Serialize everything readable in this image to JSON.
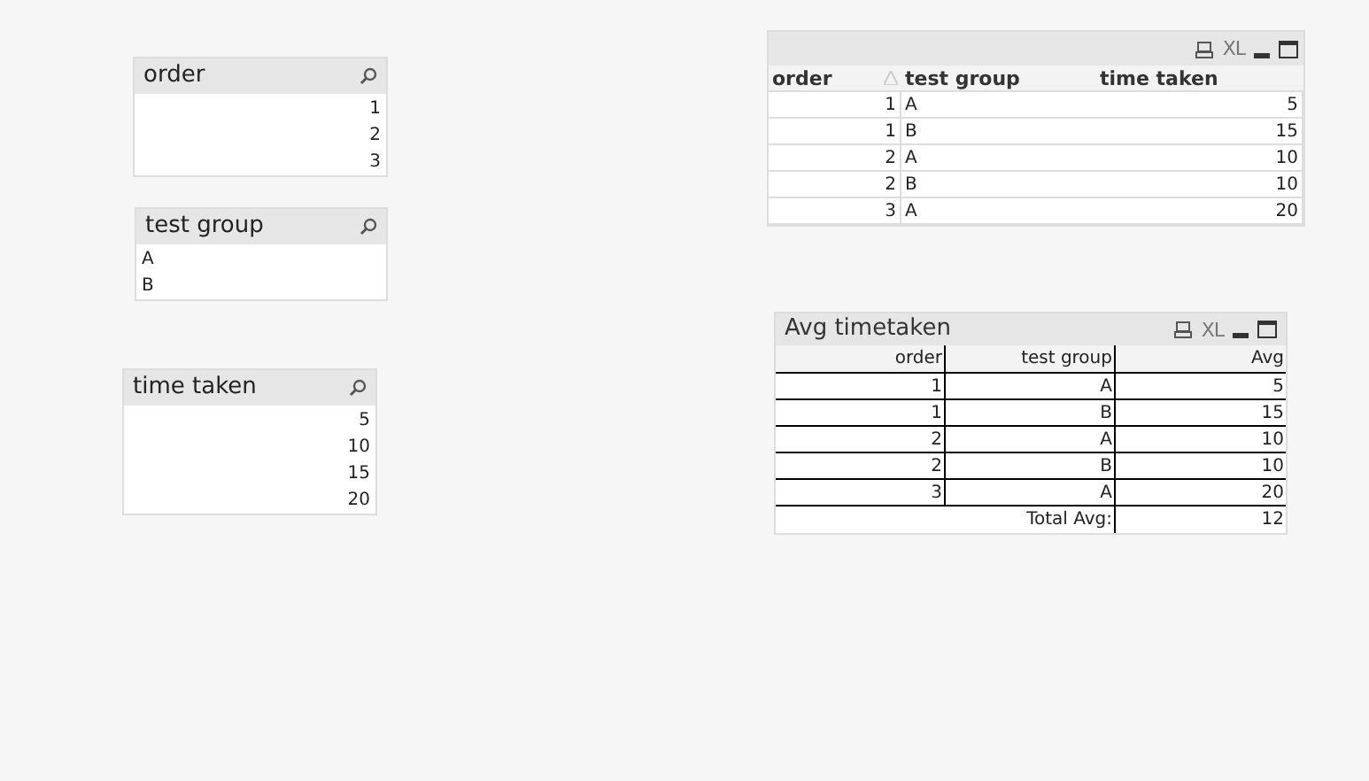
{
  "listboxes": [
    {
      "title": "order",
      "kind": "numeric",
      "values": [
        "1",
        "2",
        "3"
      ]
    },
    {
      "title": "test group",
      "kind": "text",
      "values": [
        "A",
        "B"
      ]
    },
    {
      "title": "time taken",
      "kind": "numeric",
      "values": [
        "5",
        "10",
        "15",
        "20"
      ]
    }
  ],
  "table_box": {
    "excel_label": "XL",
    "columns": [
      {
        "label": "order",
        "sorted": true
      },
      {
        "label": "test group",
        "sorted": false
      },
      {
        "label": "time taken",
        "sorted": false
      }
    ],
    "rows": [
      [
        "1",
        "A",
        "5"
      ],
      [
        "1",
        "B",
        "15"
      ],
      [
        "2",
        "A",
        "10"
      ],
      [
        "2",
        "B",
        "10"
      ],
      [
        "3",
        "A",
        "20"
      ]
    ]
  },
  "chart": {
    "title": "Avg timetaken",
    "excel_label": "XL",
    "columns": [
      "order",
      "test group",
      "Avg"
    ],
    "rows": [
      [
        "1",
        "A",
        "5"
      ],
      [
        "1",
        "B",
        "15"
      ],
      [
        "2",
        "A",
        "10"
      ],
      [
        "2",
        "B",
        "10"
      ],
      [
        "3",
        "A",
        "20"
      ]
    ],
    "total_label": "Total Avg:",
    "total_value": "12"
  }
}
